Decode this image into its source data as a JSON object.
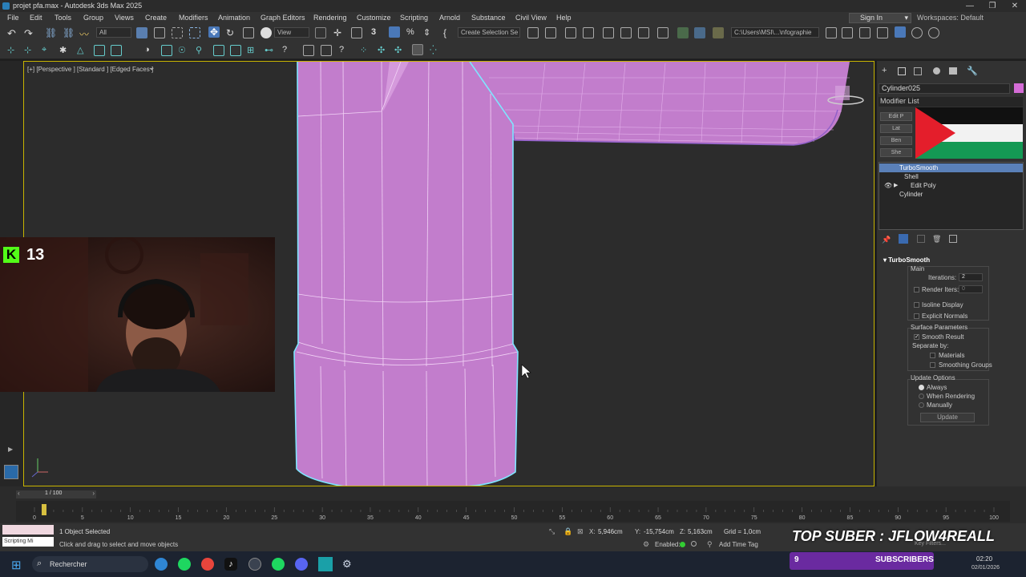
{
  "window": {
    "title": "projet pfa.max - Autodesk 3ds Max 2025",
    "controls": [
      "—",
      "❐",
      "✕"
    ]
  },
  "menubar": {
    "items": [
      "File",
      "Edit",
      "Tools",
      "Group",
      "Views",
      "Create",
      "Modifiers",
      "Animation",
      "Graph Editors",
      "Rendering",
      "Customize",
      "Scripting",
      "Arnold",
      "Substance",
      "Civil View",
      "Help"
    ],
    "sign_in": "Sign In",
    "workspaces_label": "Workspaces:",
    "workspaces_value": "Default"
  },
  "toolbar": {
    "selection_filter": "All",
    "reference_coord": "View",
    "selection_set": "Create Selection Se",
    "project_path": "C:\\Users\\MSI\\...\\nfographie"
  },
  "viewport": {
    "label": "[+] [Perspective ] [Standard ] [Edged Faces ]",
    "object_color": "#c77fd0",
    "border_color": "#c8b400",
    "filter_icon": "funnel-icon"
  },
  "command_panel": {
    "object_name": "Cylinder025",
    "modifier_list_label": "Modifier List",
    "buttons": [
      "Edit P",
      "Lat",
      "Ben",
      "She"
    ],
    "stack": [
      {
        "label": "TurboSmooth",
        "selected": true
      },
      {
        "label": "Shell",
        "selected": false
      },
      {
        "label": "Edit Poly",
        "selected": false
      },
      {
        "label": "Cylinder",
        "selected": false
      }
    ],
    "rollout": {
      "title": "TurboSmooth",
      "main_label": "Main",
      "iterations_label": "Iterations:",
      "iterations_value": "2",
      "render_iters_label": "Render Iters:",
      "render_iters_value": "0",
      "isoline_label": "Isoline Display",
      "explicit_normals_label": "Explicit Normals",
      "surface_params_label": "Surface Parameters",
      "smooth_result_label": "Smooth Result",
      "separate_by_label": "Separate by:",
      "materials_label": "Materials",
      "smoothing_groups_label": "Smoothing Groups",
      "update_options_label": "Update Options",
      "always_label": "Always",
      "when_rendering_label": "When Rendering",
      "manually_label": "Manually",
      "update_button": "Update"
    }
  },
  "timeline": {
    "frame_label": "1 / 100",
    "ticks": [
      "0",
      "5",
      "10",
      "15",
      "20",
      "25",
      "30",
      "35",
      "40",
      "45",
      "50",
      "55",
      "60",
      "65",
      "70",
      "75",
      "80",
      "85",
      "90",
      "95",
      "100"
    ],
    "current_frame": 1,
    "total_frames": 100
  },
  "statusbar": {
    "scripting_label": "Scripting Mi",
    "selected_text": "1 Object Selected",
    "prompt_text": "Click and drag to select and move objects",
    "x_label": "X:",
    "x_value": "5,946cm",
    "y_label": "Y:",
    "y_value": "-15,754cm",
    "z_label": "Z:",
    "z_value": "5,163cm",
    "grid_label": "Grid = 1,0cm",
    "enabled_label": "Enabled:",
    "add_time_tag": "Add Time Tag",
    "key_filters": "Key Filters..."
  },
  "taskbar": {
    "search_label": "Rechercher",
    "time": "02:20",
    "date": "02/01/2026"
  },
  "overlays": {
    "kick_count": "13",
    "top_suber": "TOP SUBER : JFLOW4REALL",
    "subscribers_label": "SUBSCRIBERS",
    "subscribers_count": "9"
  }
}
